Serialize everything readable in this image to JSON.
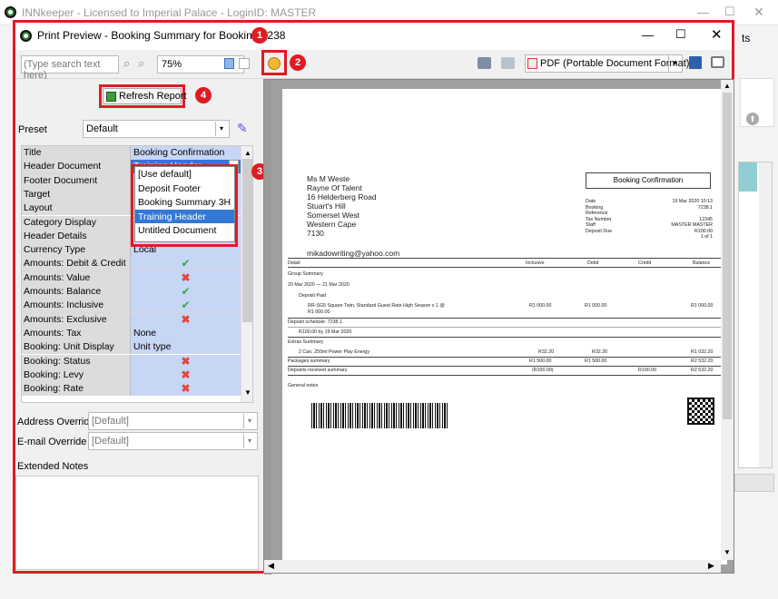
{
  "outer": {
    "title": "INNkeeper - Licensed to Imperial Palace - LoginID: MASTER",
    "clipped_text": "ts"
  },
  "window": {
    "title": "Print Preview - Booking Summary for Booking 7238"
  },
  "toolbar": {
    "search_placeholder": "(Type search text here)",
    "zoom": "75%",
    "pdf_format": "PDF (Portable Document Format)"
  },
  "badges": {
    "b1": "1",
    "b2": "2",
    "b3": "3",
    "b4": "4"
  },
  "left": {
    "refresh": "Refresh Report",
    "preset_label": "Preset",
    "preset_value": "Default",
    "rows": [
      {
        "k": "Title",
        "v": "Booking Confirmation",
        "t": "text"
      },
      {
        "k": "Header Document",
        "v": "Training Header",
        "t": "sel"
      },
      {
        "k": "Footer Document",
        "v": "",
        "t": "text"
      },
      {
        "k": "Target",
        "v": "",
        "t": "text"
      },
      {
        "k": "Layout",
        "v": "",
        "t": "text"
      },
      {
        "k": "Category Display",
        "v": "",
        "t": "text"
      },
      {
        "k": "Header Details",
        "v": "",
        "t": "text"
      },
      {
        "k": "Currency Type",
        "v": "Local",
        "t": "text"
      },
      {
        "k": "Amounts: Debit & Credit",
        "v": "",
        "t": "check"
      },
      {
        "k": "Amounts: Value",
        "v": "",
        "t": "cross"
      },
      {
        "k": "Amounts: Balance",
        "v": "",
        "t": "check"
      },
      {
        "k": "Amounts: Inclusive",
        "v": "",
        "t": "check"
      },
      {
        "k": "Amounts: Exclusive",
        "v": "",
        "t": "cross"
      },
      {
        "k": "Amounts: Tax",
        "v": "None",
        "t": "text"
      },
      {
        "k": "Booking: Unit Display",
        "v": "Unit type",
        "t": "text"
      },
      {
        "k": "Booking: Status",
        "v": "",
        "t": "cross"
      },
      {
        "k": "Booking: Levy",
        "v": "",
        "t": "cross"
      },
      {
        "k": "Booking: Rate",
        "v": "",
        "t": "cross"
      }
    ],
    "dropdown": [
      "[Use default]",
      "Deposit Footer",
      "Booking Summary 3H",
      "Training Header",
      "Untitled Document"
    ],
    "address_label": "Address Override",
    "address_value": "[Default]",
    "email_label": "E-mail Override",
    "email_value": "[Default]",
    "notes_label": "Extended Notes"
  },
  "doc": {
    "addr": [
      "Ms M Weste",
      "Rayne Of Talent",
      "16 Helderberg Road",
      "Stuart's Hill",
      "Somerset West",
      "Western Cape",
      "7130"
    ],
    "email": "mikadowriting@yahoo.com",
    "heading": "Booking Confirmation",
    "meta": [
      [
        "Date",
        "19 Mar 2020 10:13"
      ],
      [
        "Booking",
        "7238.1"
      ],
      [
        "Reference",
        ""
      ],
      [
        "Tax Number",
        "12345"
      ],
      [
        "Staff",
        "MASTER MASTER"
      ],
      [
        "Deposit Due",
        "R100.00"
      ],
      [
        "",
        "1 of 1"
      ]
    ],
    "cols": [
      "Detail",
      "Inclusive",
      "Debit",
      "Credit",
      "Balance"
    ],
    "lines": {
      "group": "Group Summary",
      "dates": "20 Mar 2020 — 21 Mar 2020",
      "deposit_paid": "Deposit Paid",
      "room1": "RR-SG5 Square Twin, Standard Guest Rate High Season x 1 @",
      "room2": "R1 000.00",
      "room_inc": "R1 000.00",
      "room_deb": "R1 000.00",
      "room_bal": "R1 000.00",
      "sched": "Deposit schedule: 7238.1",
      "sched2": "R100.00 by 19 Mar 2020",
      "extras": "Extras Summary",
      "extra1": "2 Can, 250ml Power Play Energy",
      "ex_inc": "R32.20",
      "ex_deb": "R32.20",
      "ex_bal": "R1 032.20",
      "pack": "Packages summary",
      "pk_inc": "R1 500.00",
      "pk_deb": "R1 500.00",
      "pk_bal": "R2 532.20",
      "deps": "Deposits received summary",
      "dp_inc": "(R100.00)",
      "dp_cr": "R100.00",
      "dp_bal": "R2 532.20",
      "notes": "General notes"
    }
  }
}
